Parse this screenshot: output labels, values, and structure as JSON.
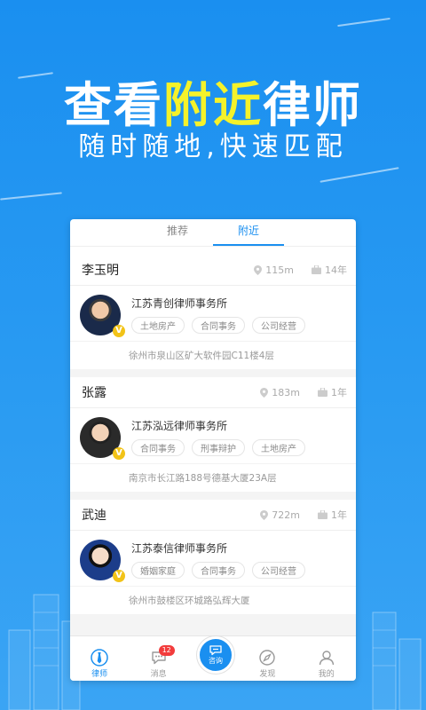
{
  "hero": {
    "title_prefix": "查看",
    "title_highlight": "附近",
    "title_suffix": "律师",
    "subtitle": "随时随地,快速匹配"
  },
  "tabs": [
    {
      "label": "推荐",
      "active": false
    },
    {
      "label": "附近",
      "active": true
    }
  ],
  "lawyers": [
    {
      "name": "李玉明",
      "distance": "115m",
      "years": "14年",
      "firm": "江苏青创律师事务所",
      "tags": [
        "土地房产",
        "合同事务",
        "公司经营"
      ],
      "address": "徐州市泉山区矿大软件园C11楼4层"
    },
    {
      "name": "张露",
      "distance": "183m",
      "years": "1年",
      "firm": "江苏泓远律师事务所",
      "tags": [
        "合同事务",
        "刑事辩护",
        "土地房产"
      ],
      "address": "南京市长江路188号德基大厦23A层"
    },
    {
      "name": "武迪",
      "distance": "722m",
      "years": "1年",
      "firm": "江苏泰信律师事务所",
      "tags": [
        "婚姻家庭",
        "合同事务",
        "公司经营"
      ],
      "address": "徐州市鼓楼区环城路弘辉大厦"
    }
  ],
  "nav": {
    "lawyer": "律师",
    "message": "消息",
    "message_badge": "12",
    "consult": "咨询",
    "discover": "发现",
    "mine": "我的"
  },
  "colors": {
    "brand_blue": "#1a8ff0",
    "highlight_yellow": "#f5f22a",
    "verified_gold": "#f2c318",
    "badge_red": "#f23c3c"
  },
  "icons": [
    "lawyer-tie-icon",
    "message-bubble-icon",
    "consult-icon",
    "compass-icon",
    "person-icon",
    "location-pin-icon",
    "briefcase-icon",
    "verified-badge-icon"
  ]
}
